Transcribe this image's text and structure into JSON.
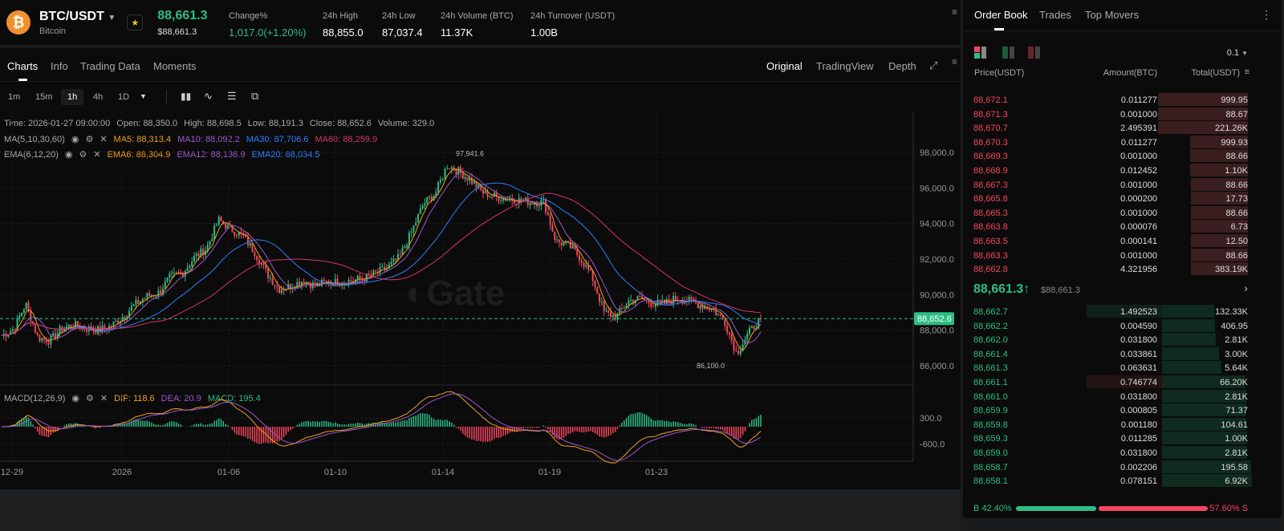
{
  "header": {
    "pair": "BTC/USDT",
    "name": "Bitcoin",
    "price": "88,661.3",
    "price_usd": "$88,661.3",
    "stats": [
      {
        "label": "Change%",
        "value": "1,017.0(+1.20%)",
        "green": true
      },
      {
        "label": "24h High",
        "value": "88,855.0"
      },
      {
        "label": "24h Low",
        "value": "87,037.4"
      },
      {
        "label": "24h Volume (BTC)",
        "value": "11.37K"
      },
      {
        "label": "24h Turnover (USDT)",
        "value": "1.00B"
      }
    ]
  },
  "tabs": [
    "Charts",
    "Info",
    "Trading Data",
    "Moments"
  ],
  "views": [
    "Original",
    "TradingView",
    "Depth"
  ],
  "intervals": [
    "1m",
    "15m",
    "1h",
    "4h",
    "1D"
  ],
  "legend": {
    "ohlc": "Time: 2026-01-27 09:00:00",
    "open": "Open: 88,350.0",
    "high": "High: 88,698.5",
    "low": "Low: 88,191.3",
    "close": "Close: 88,652.6",
    "volume": "Volume: 329.0",
    "ma": "MA(5,10,30,60)",
    "ma5": "MA5: 88,313.4",
    "ma10": "MA10: 88,092.2",
    "ma30": "MA30: 87,706.6",
    "ma60": "MA60: 88,259.9",
    "ema": "EMA(6,12,20)",
    "ema6": "EMA6: 88,304.9",
    "ema12": "EMA12: 88,136.9",
    "ema20": "EMA20: 88,034.5",
    "macd": "MACD(12,26,9)",
    "dif": "DIF: 118.6",
    "dea": "DEA: 20.9",
    "macdv": "MACD: 195.4"
  },
  "colors": {
    "up": "#2ebd85",
    "down": "#f6465d",
    "ma5": "#f0a020",
    "ma10": "#9b59d0",
    "ma30": "#2f7fff",
    "ma60": "#d6336c"
  },
  "chart_data": {
    "type": "candlestick",
    "watermark": "Gate",
    "yticks": [
      "98,000.0",
      "96,000.0",
      "94,000.0",
      "92,000.0",
      "90,000.0",
      "88,000.0",
      "86,000.0"
    ],
    "ytick_values": [
      98000,
      96000,
      94000,
      92000,
      90000,
      88000,
      86000
    ],
    "ylim": [
      85500,
      99500
    ],
    "macd_ticks": [
      "300.0",
      "-600.0"
    ],
    "xticks": [
      "12-29",
      "2026",
      "01-06",
      "01-10",
      "01-14",
      "01-19",
      "01-23"
    ],
    "last_price": "88,652.6",
    "last_value": 88652.6,
    "high_label": "97,941.6",
    "low_label": "86,100.0",
    "close_path": [
      87700,
      88070,
      89500,
      87600,
      87400,
      88100,
      88300,
      88100,
      88000,
      88200,
      88750,
      89400,
      89900,
      90100,
      91000,
      91200,
      92100,
      92600,
      94200,
      93700,
      93300,
      92400,
      91200,
      90300,
      90500,
      90800,
      90500,
      90700,
      90700,
      90800,
      90900,
      91200,
      91500,
      92100,
      93500,
      95100,
      95700,
      97300,
      96900,
      96400,
      95700,
      95500,
      95400,
      95300,
      95200,
      95200,
      93000,
      92800,
      92100,
      91000,
      89000,
      88750,
      89650,
      89800,
      89500,
      89500,
      89800,
      89650,
      89400,
      89200,
      88500,
      86700,
      87850,
      88650
    ]
  },
  "orderbook": {
    "tabs": [
      "Order Book",
      "Trades",
      "Top Movers"
    ],
    "precision": "0.1",
    "headers": [
      "Price(USDT)",
      "Amount(BTC)",
      "Total(USDT)"
    ],
    "asks": [
      [
        "88,672.1",
        "0.011277",
        "999.95",
        1
      ],
      [
        "88,671.3",
        "0.001000",
        "88.67",
        1
      ],
      [
        "88,670.7",
        "2.495391",
        "221.26K",
        1
      ],
      [
        "88,670.3",
        "0.011277",
        "999.93",
        0.64
      ],
      [
        "88,669.3",
        "0.001000",
        "88.66",
        0.64
      ],
      [
        "88,668.9",
        "0.012452",
        "1.10K",
        0.64
      ],
      [
        "88,667.3",
        "0.001000",
        "88.66",
        0.63
      ],
      [
        "88,665.8",
        "0.000200",
        "17.73",
        0.63
      ],
      [
        "88,665.3",
        "0.001000",
        "88.66",
        0.63
      ],
      [
        "88,663.8",
        "0.000076",
        "6.73",
        0.63
      ],
      [
        "88,663.5",
        "0.000141",
        "12.50",
        0.63
      ],
      [
        "88,663.3",
        "0.001000",
        "88.66",
        0.63
      ],
      [
        "88,662.8",
        "4.321956",
        "383.19K",
        0.63
      ]
    ],
    "mid_price": "88,661.3",
    "mid_usd": "$88,661.3",
    "bids": [
      [
        "88,662.7",
        "1.492523",
        "132.33K",
        0.58,
        1
      ],
      [
        "88,662.2",
        "0.004590",
        "406.95",
        0.59,
        0
      ],
      [
        "88,662.0",
        "0.031800",
        "2.81K",
        0.6,
        0
      ],
      [
        "88,661.4",
        "0.033861",
        "3.00K",
        0.63,
        0
      ],
      [
        "88,661.3",
        "0.063631",
        "5.64K",
        0.66,
        0
      ],
      [
        "88,661.1",
        "0.746774",
        "66.20K",
        0.93,
        2
      ],
      [
        "88,661.0",
        "0.031800",
        "2.81K",
        0.94,
        0
      ],
      [
        "88,659.9",
        "0.000805",
        "71.37",
        0.94,
        0
      ],
      [
        "88,659.8",
        "0.001180",
        "104.61",
        0.94,
        0
      ],
      [
        "88,659.3",
        "0.011285",
        "1.00K",
        0.95,
        0
      ],
      [
        "88,659.0",
        "0.031800",
        "2.81K",
        0.95,
        0
      ],
      [
        "88,658.7",
        "0.002206",
        "195.58",
        0.99,
        0
      ],
      [
        "88,658.1",
        "0.078151",
        "6.92K",
        1,
        0
      ]
    ],
    "buy_pct": "B 42.40%",
    "sell_pct": "57.60% S",
    "buy_ratio": 0.424
  }
}
